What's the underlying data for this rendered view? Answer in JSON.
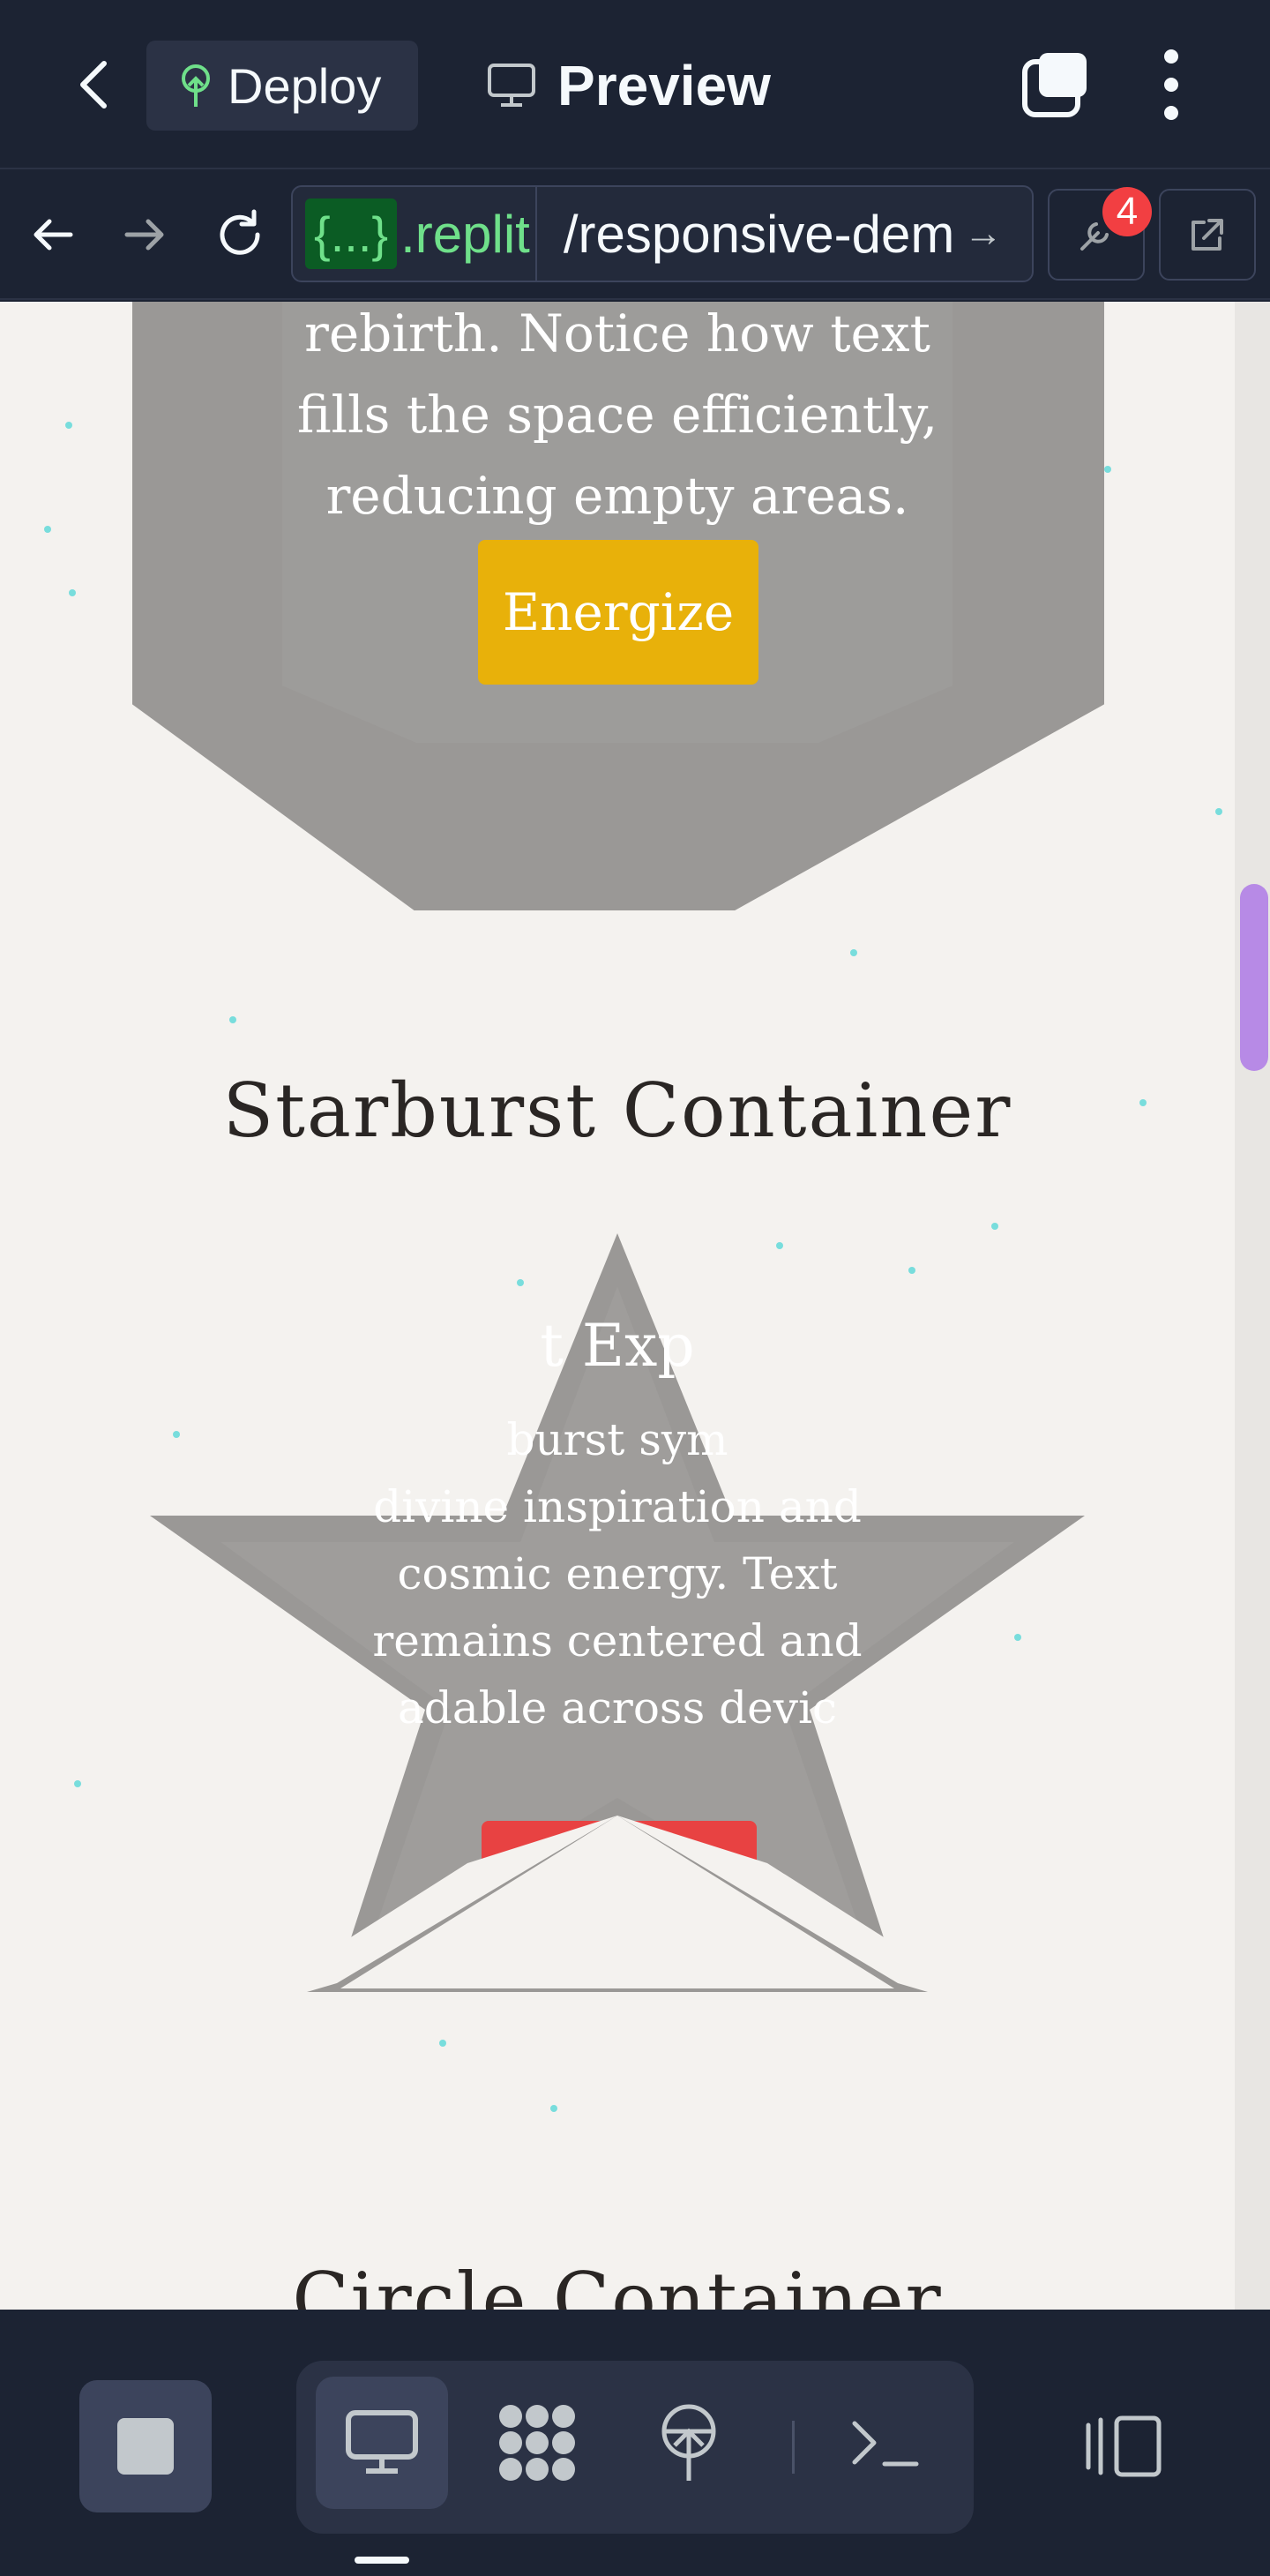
{
  "header": {
    "deploy_label": "Deploy",
    "preview_label": "Preview"
  },
  "urlbar": {
    "badge": "{...}",
    "domain": ".replit",
    "path": "/responsive-dem",
    "notification_count": "4"
  },
  "page": {
    "octagon": {
      "text_lines": [
        "rebirth. Notice how text",
        "fills the space efficiently,",
        "reducing empty areas."
      ],
      "button_label": "Energize",
      "button_color": "#e8b10a"
    },
    "starburst": {
      "heading": "Starburst Container",
      "card_title": "t Exp",
      "card_lines": [
        "burst sym",
        "divine inspiration and",
        "cosmic energy. Text",
        "remains centered and",
        "adable across devic"
      ],
      "button_color": "#e84242"
    },
    "circle": {
      "heading": "Circle Container"
    }
  },
  "colors": {
    "accent_blue": "#2563eb",
    "bar_bg": "#1c2333",
    "page_bg": "#f4f2ef",
    "scroll_thumb": "#b78ae6"
  },
  "icons": {
    "back": "chevron-left-icon",
    "deploy": "deploy-icon",
    "preview": "monitor-icon",
    "tabs": "tabs-icon",
    "menu": "more-vertical-icon",
    "nav_back": "arrow-left-icon",
    "nav_forward": "arrow-right-icon",
    "reload": "reload-icon",
    "devtools": "wrench-icon",
    "open_external": "external-link-icon",
    "settings": "gear-icon",
    "stop": "stop-icon",
    "webview": "monitor-icon",
    "workflows": "workflow-icon",
    "deployments": "deploy-icon",
    "shell": "terminal-icon",
    "panels": "panel-layout-icon"
  }
}
